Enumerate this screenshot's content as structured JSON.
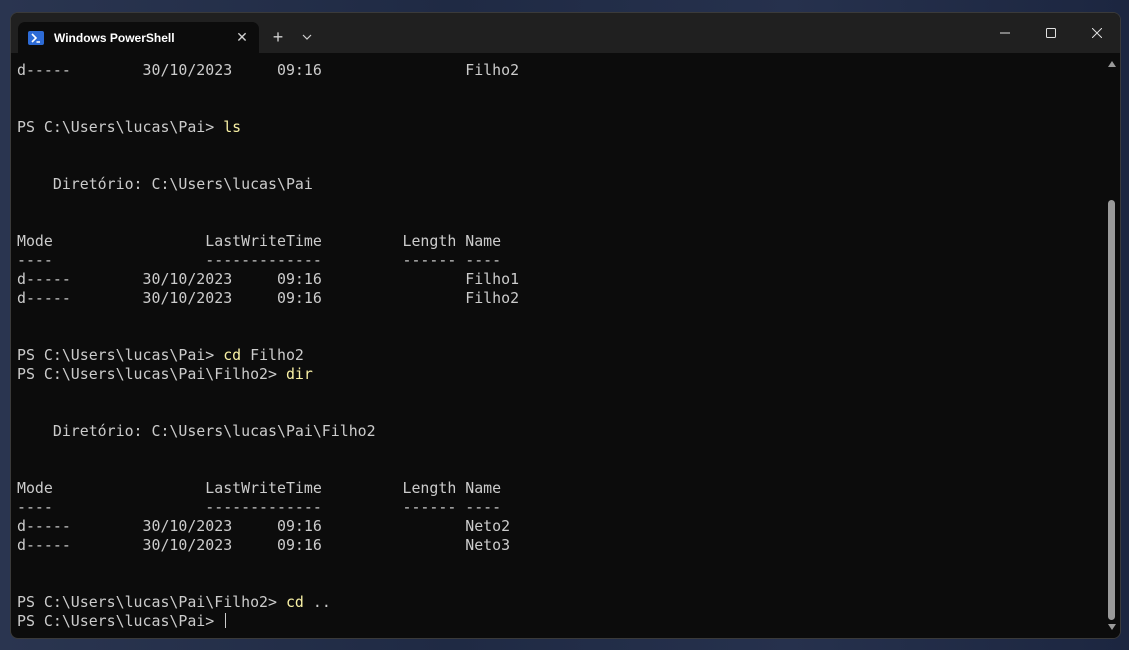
{
  "window": {
    "tab_title": "Windows PowerShell",
    "tab_close": "✕",
    "new_tab": "+",
    "icon": "powershell-icon"
  },
  "terminal": {
    "lines": [
      {
        "t": "d-----        30/10/2023     09:16                Filho2"
      },
      {
        "t": ""
      },
      {
        "t": ""
      },
      {
        "prompt": "PS C:\\Users\\lucas\\Pai> ",
        "cmd": "ls",
        "arg": ""
      },
      {
        "t": ""
      },
      {
        "t": ""
      },
      {
        "t": "    Diretório: C:\\Users\\lucas\\Pai"
      },
      {
        "t": ""
      },
      {
        "t": ""
      },
      {
        "t": "Mode                 LastWriteTime         Length Name"
      },
      {
        "t": "----                 -------------         ------ ----"
      },
      {
        "t": "d-----        30/10/2023     09:16                Filho1"
      },
      {
        "t": "d-----        30/10/2023     09:16                Filho2"
      },
      {
        "t": ""
      },
      {
        "t": ""
      },
      {
        "prompt": "PS C:\\Users\\lucas\\Pai> ",
        "cmd": "cd",
        "arg": " Filho2"
      },
      {
        "prompt": "PS C:\\Users\\lucas\\Pai\\Filho2> ",
        "cmd": "dir",
        "arg": ""
      },
      {
        "t": ""
      },
      {
        "t": ""
      },
      {
        "t": "    Diretório: C:\\Users\\lucas\\Pai\\Filho2"
      },
      {
        "t": ""
      },
      {
        "t": ""
      },
      {
        "t": "Mode                 LastWriteTime         Length Name"
      },
      {
        "t": "----                 -------------         ------ ----"
      },
      {
        "t": "d-----        30/10/2023     09:16                Neto2"
      },
      {
        "t": "d-----        30/10/2023     09:16                Neto3"
      },
      {
        "t": ""
      },
      {
        "t": ""
      },
      {
        "prompt": "PS C:\\Users\\lucas\\Pai\\Filho2> ",
        "cmd": "cd",
        "arg": " .."
      },
      {
        "prompt": "PS C:\\Users\\lucas\\Pai> ",
        "cmd": "",
        "arg": "",
        "cursor": true
      }
    ]
  },
  "colors": {
    "terminal_bg": "#0c0c0c",
    "text": "#cccccc",
    "command": "#f9f1a5",
    "titlebar": "#202020"
  }
}
